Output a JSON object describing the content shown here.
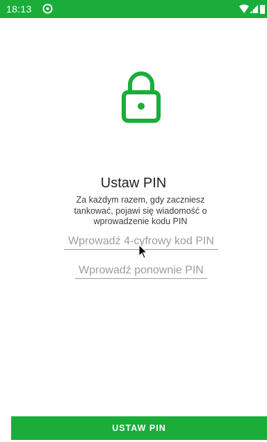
{
  "status_bar": {
    "time": "18:13",
    "app_icon": "circle-sync-icon",
    "indicators": [
      "wifi-icon",
      "signal-icon",
      "battery-icon"
    ],
    "color": "#1aad3a"
  },
  "lock": {
    "icon": "lock-icon",
    "color": "#1aad3a"
  },
  "title": "Ustaw PIN",
  "description": "Za każdym razem, gdy zaczniesz tankować, pojawi się wiadomość o wprowadzenie kodu PIN",
  "pin_input": {
    "placeholder": "Wprowadź 4-cyfrowy kod PIN",
    "value": ""
  },
  "pin_repeat_input": {
    "placeholder": "Wprowadź ponownie PIN",
    "value": ""
  },
  "submit_label": "USTAW PIN",
  "accent_color": "#1aad3a"
}
